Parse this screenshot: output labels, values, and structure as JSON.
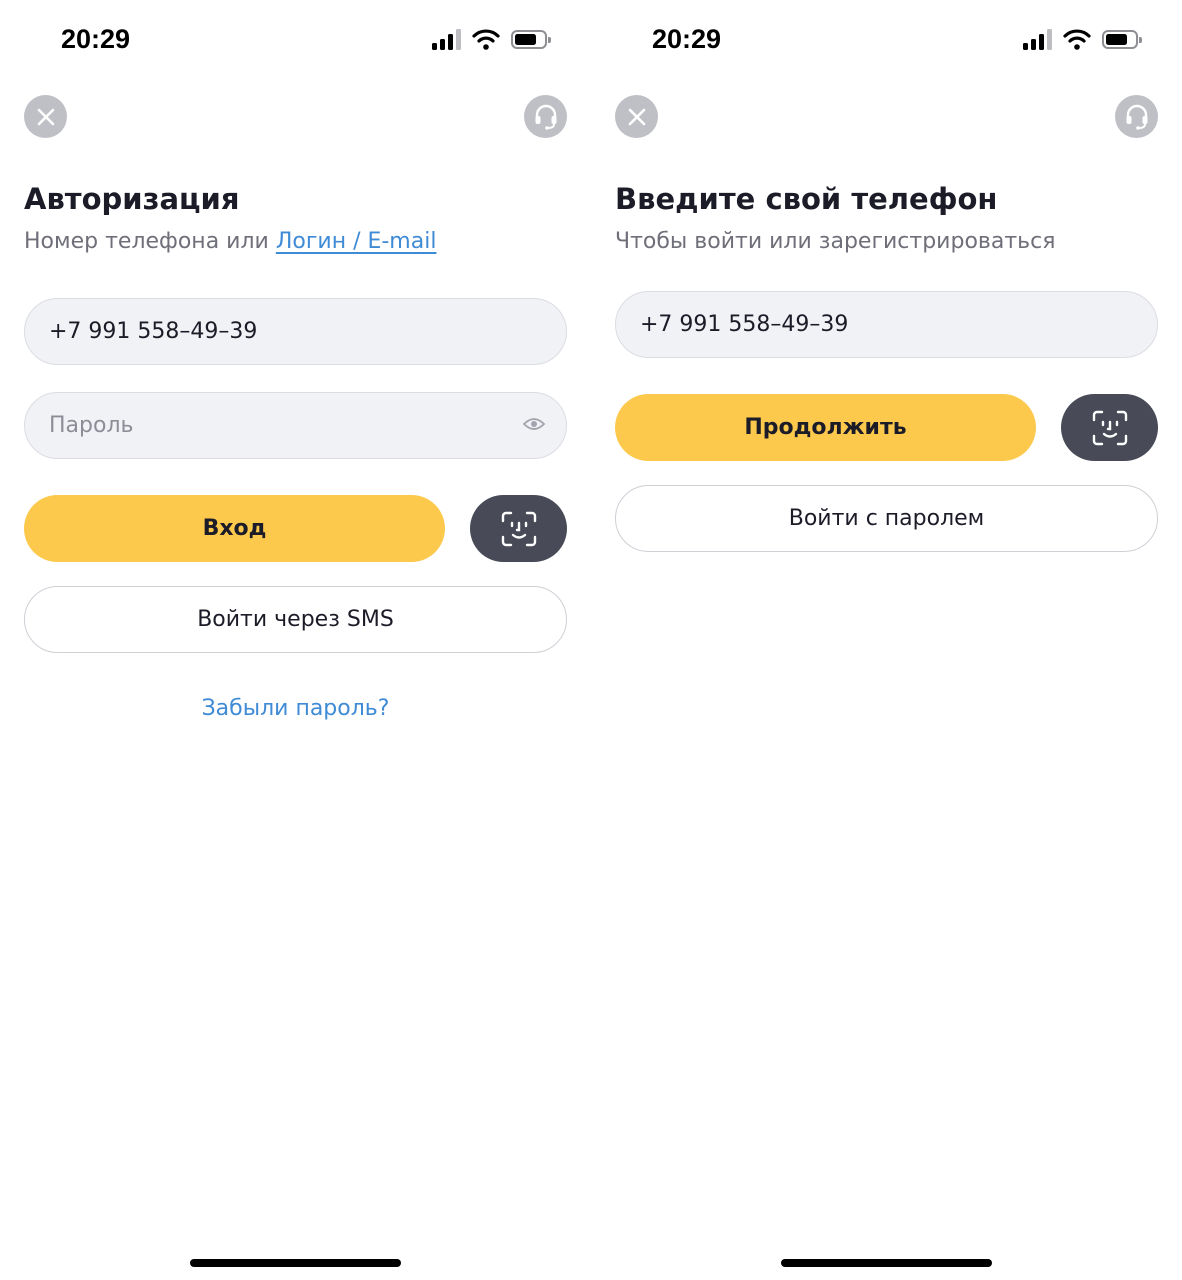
{
  "colors": {
    "accent_yellow": "#fcc94d",
    "link_blue": "#3f8bd6",
    "face_button": "#484b57",
    "field_bg": "#f1f2f6"
  },
  "icons": {
    "close": "close-icon",
    "support": "headset-icon",
    "face_id": "face-id-icon",
    "eye": "eye-icon"
  },
  "left": {
    "status": {
      "time": "20:29"
    },
    "title": "Авторизация",
    "subtitle_prefix": "Номер телефона или ",
    "subtitle_link": "Логин / E-mail",
    "phone_value": "+7 991 558–49–39",
    "password_placeholder": "Пароль",
    "login_button": "Вход",
    "sms_button": "Войти через SMS",
    "forgot_link": "Забыли пароль?"
  },
  "right": {
    "status": {
      "time": "20:29"
    },
    "title": "Введите свой телефон",
    "subtitle": "Чтобы войти или зарегистрироваться",
    "phone_value": "+7 991 558–49–39",
    "continue_button": "Продолжить",
    "password_button": "Войти с паролем"
  }
}
